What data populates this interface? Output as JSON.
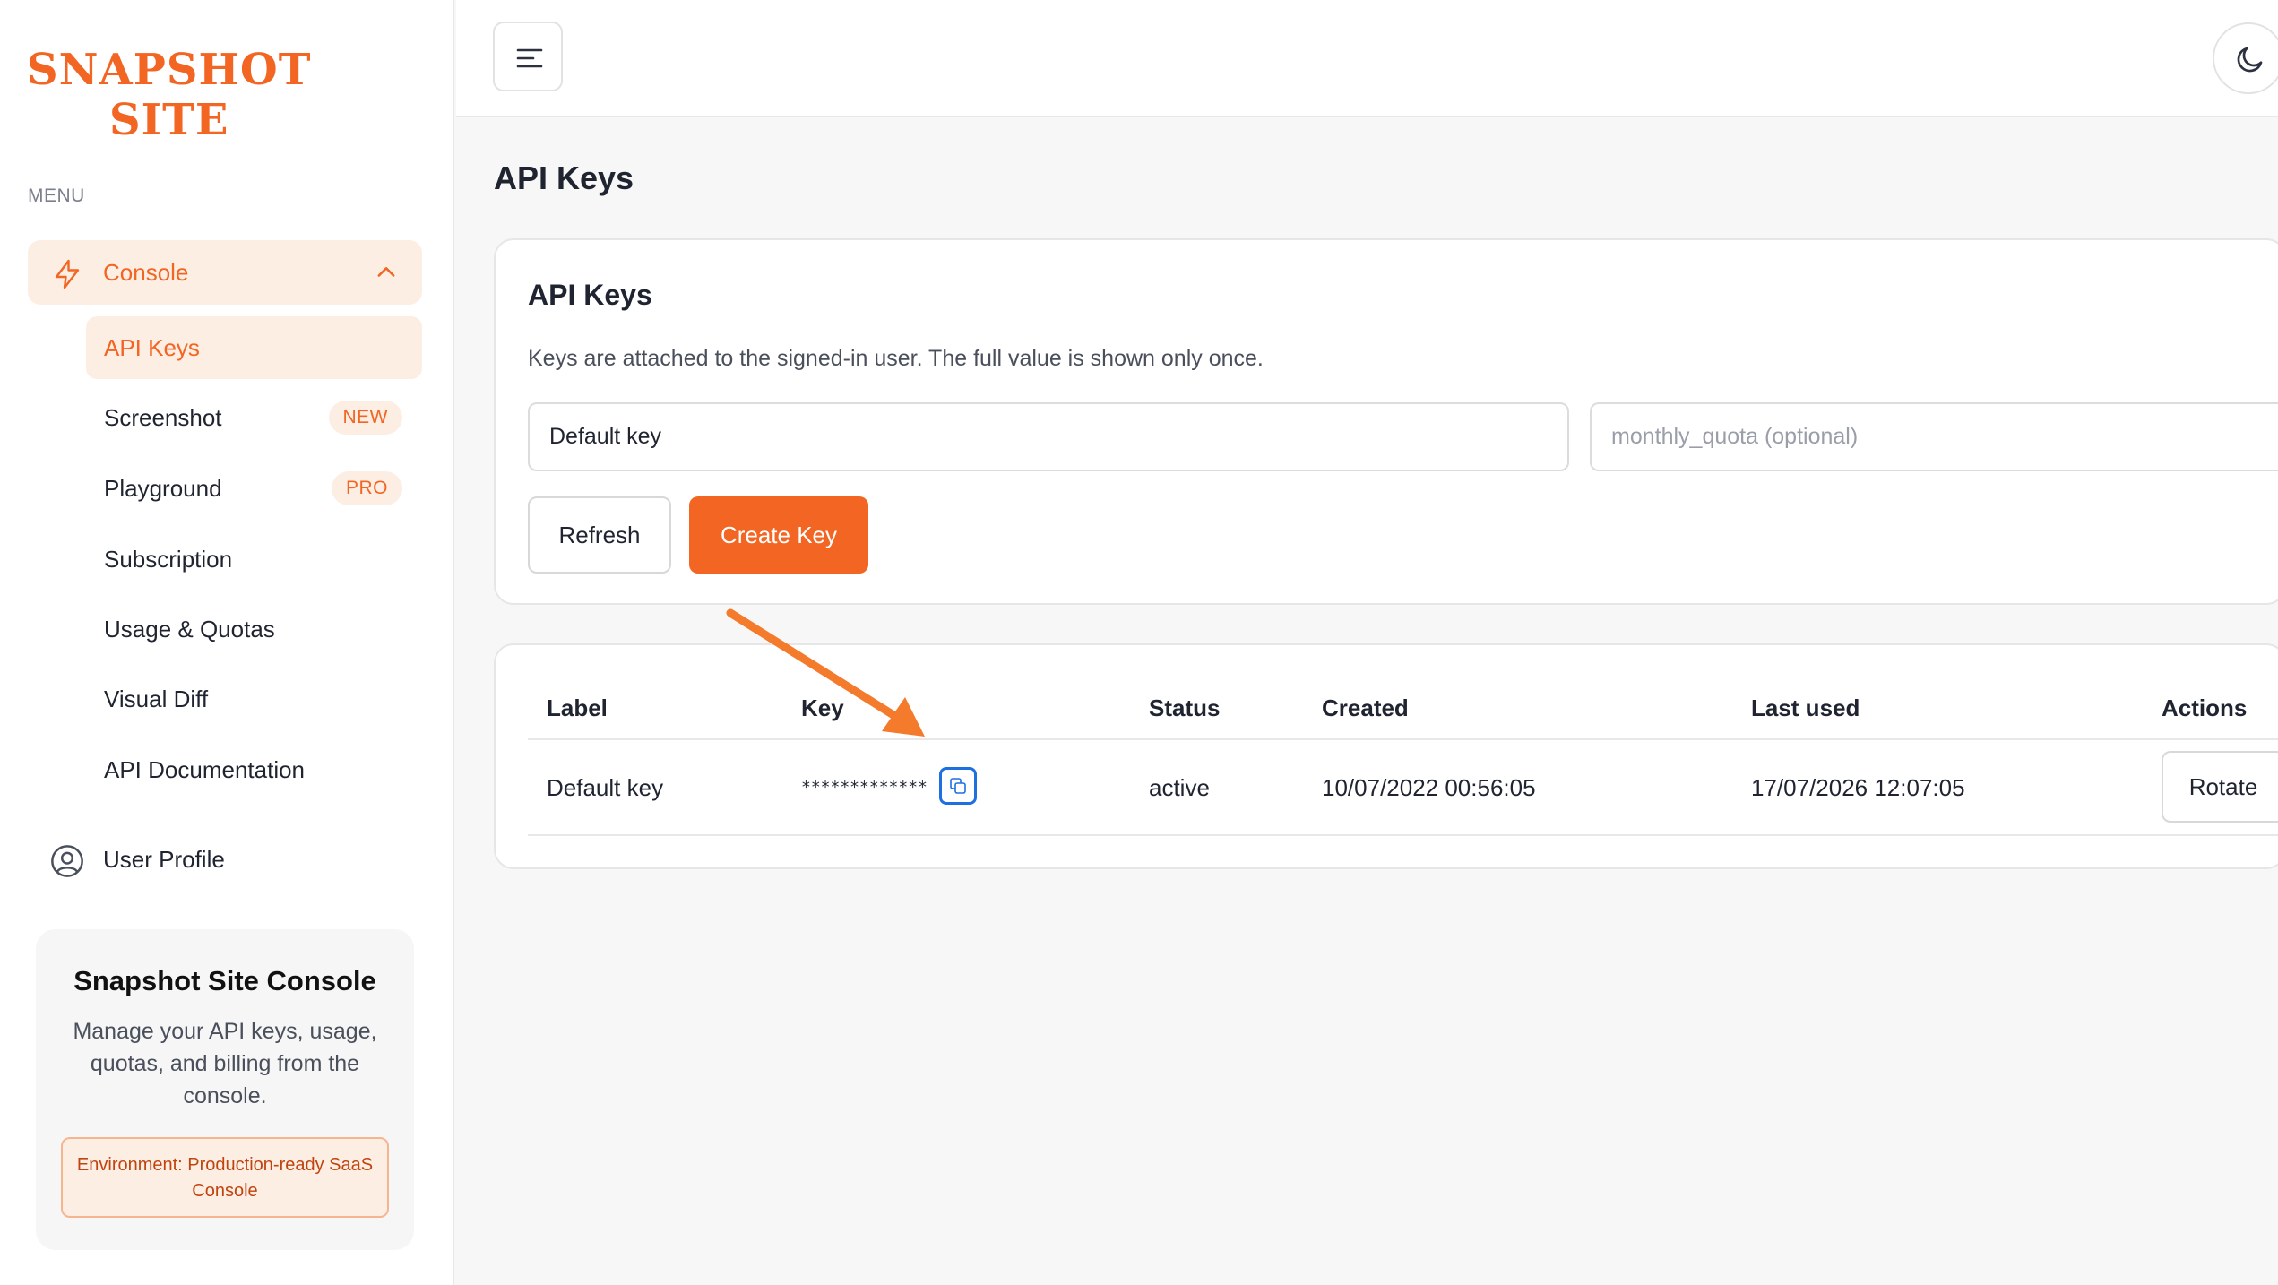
{
  "brand": {
    "line1": "SNAPSHOT",
    "line2": "SITE",
    "color": "#f26522"
  },
  "sidebar": {
    "menu_heading": "MENU",
    "console": {
      "label": "Console",
      "icon": "lightning-icon"
    },
    "items": [
      {
        "label": "API Keys",
        "active": true
      },
      {
        "label": "Screenshot",
        "badge": "NEW"
      },
      {
        "label": "Playground",
        "badge": "PRO"
      },
      {
        "label": "Subscription"
      },
      {
        "label": "Usage & Quotas"
      },
      {
        "label": "Visual Diff"
      },
      {
        "label": "API Documentation"
      }
    ],
    "profile": {
      "label": "User Profile",
      "icon": "user-circle-icon"
    },
    "promo": {
      "title": "Snapshot Site Console",
      "description": "Manage your API keys, usage, quotas, and billing from the console.",
      "environment": "Environment: Production-ready SaaS Console"
    }
  },
  "page": {
    "title": "API Keys"
  },
  "create_card": {
    "title": "API Keys",
    "description": "Keys are attached to the signed-in user. The full value is shown only once.",
    "label_input_value": "Default key",
    "quota_input_placeholder": "monthly_quota (optional)",
    "refresh_label": "Refresh",
    "create_label": "Create Key"
  },
  "table": {
    "headers": {
      "label": "Label",
      "key": "Key",
      "status": "Status",
      "created": "Created",
      "last_used": "Last used",
      "actions": "Actions"
    },
    "rows": [
      {
        "label": "Default key",
        "key": "*************",
        "status": "active",
        "created": "10/07/2022 00:56:05",
        "last_used": "17/07/2026 12:07:05",
        "action": "Rotate"
      }
    ]
  },
  "colors": {
    "accent": "#f26522",
    "accent_soft": "#fdeee4",
    "copy_icon": "#1e6fe0"
  }
}
